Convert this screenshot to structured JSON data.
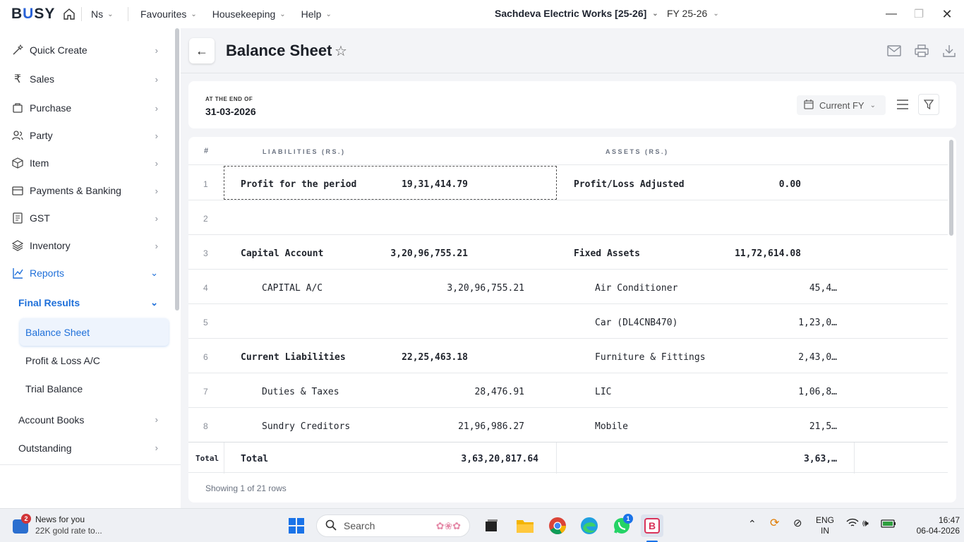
{
  "app": {
    "logo_prefix": "B",
    "logo_accent": "U",
    "logo_suffix": "SY"
  },
  "topnav": {
    "company_short": "Ns",
    "favourites": "Favourites",
    "housekeeping": "Housekeeping",
    "help": "Help"
  },
  "company": {
    "name": "Sachdeva Electric Works [25-26]",
    "fy": "FY 25-26"
  },
  "sidebar": {
    "items": [
      {
        "label": "Quick Create",
        "icon": "wand-icon"
      },
      {
        "label": "Sales",
        "icon": "rupee-icon"
      },
      {
        "label": "Purchase",
        "icon": "bag-icon"
      },
      {
        "label": "Party",
        "icon": "users-icon"
      },
      {
        "label": "Item",
        "icon": "box-icon"
      },
      {
        "label": "Payments & Banking",
        "icon": "wallet-icon"
      },
      {
        "label": "GST",
        "icon": "document-icon"
      },
      {
        "label": "Inventory",
        "icon": "layers-icon"
      },
      {
        "label": "Reports",
        "icon": "chart-icon"
      }
    ],
    "final_results": "Final Results",
    "sub_items": [
      "Balance Sheet",
      "Profit & Loss A/C",
      "Trial Balance"
    ],
    "account_books": "Account Books",
    "outstanding": "Outstanding"
  },
  "page": {
    "title": "Balance Sheet"
  },
  "datecard": {
    "label": "AT THE END OF",
    "date": "31-03-2026",
    "period": "Current FY"
  },
  "table": {
    "col_num": "#",
    "col_liabilities": "LIABILITIES (RS.)",
    "col_assets": "ASSETS (RS.)",
    "rows": [
      {
        "n": "1",
        "l_name": "Profit for the period",
        "l_sub": "",
        "l_main": "19,31,414.79",
        "a_name": "Profit/Loss Adjusted",
        "a_sub": "",
        "a_main": "0.00"
      },
      {
        "n": "2",
        "l_name": "",
        "l_sub": "",
        "l_main": "",
        "a_name": "",
        "a_sub": "",
        "a_main": ""
      },
      {
        "n": "3",
        "l_name": "Capital Account",
        "l_sub": "",
        "l_main": "3,20,96,755.21",
        "a_name": "Fixed Assets",
        "a_sub": "",
        "a_main": "11,72,614.08"
      },
      {
        "n": "4",
        "l_name": "CAPITAL A/C",
        "l_sub": "3,20,96,755.21",
        "l_main": "",
        "a_name": "Air Conditioner",
        "a_sub": "45,4…",
        "a_main": ""
      },
      {
        "n": "5",
        "l_name": "",
        "l_sub": "",
        "l_main": "",
        "a_name": "Car (DL4CNB470)",
        "a_sub": "1,23,0…",
        "a_main": ""
      },
      {
        "n": "6",
        "l_name": "Current Liabilities",
        "l_sub": "",
        "l_main": "22,25,463.18",
        "a_name": "Furniture & Fittings",
        "a_sub": "2,43,0…",
        "a_main": ""
      },
      {
        "n": "7",
        "l_name": "Duties & Taxes",
        "l_sub": "28,476.91",
        "l_main": "",
        "a_name": "LIC",
        "a_sub": "1,06,8…",
        "a_main": ""
      },
      {
        "n": "8",
        "l_name": "Sundry Creditors",
        "l_sub": "21,96,986.27",
        "l_main": "",
        "a_name": "Mobile",
        "a_sub": "21,5…",
        "a_main": ""
      }
    ],
    "total_label": "Total",
    "total_name": "Total",
    "total_liabilities": "3,63,20,817.64",
    "total_assets": "3,63,…",
    "showing": "Showing 1 of 21 rows"
  },
  "taskbar": {
    "news_title": "News for you",
    "news_sub": "22K gold rate to...",
    "news_badge": "2",
    "search": "Search",
    "whatsapp_badge": "1",
    "lang_1": "ENG",
    "lang_2": "IN",
    "time": "16:47",
    "date": "06-04-2026"
  }
}
